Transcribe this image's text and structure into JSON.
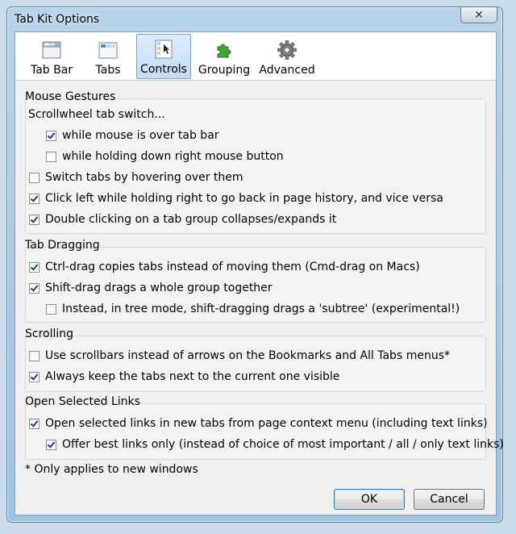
{
  "window": {
    "title": "Tab Kit Options"
  },
  "tabs": [
    {
      "label": "Tab Bar",
      "icon": "tab-bar-icon",
      "selected": false
    },
    {
      "label": "Tabs",
      "icon": "tabs-icon",
      "selected": false
    },
    {
      "label": "Controls",
      "icon": "controls-icon",
      "selected": true
    },
    {
      "label": "Grouping",
      "icon": "puzzle-piece-icon",
      "selected": false
    },
    {
      "label": "Advanced",
      "icon": "gear-icon",
      "selected": false
    }
  ],
  "mouse_gestures": {
    "heading": "Mouse Gestures",
    "scrollwheel_label": "Scrollwheel tab switch...",
    "items": [
      {
        "label": "while mouse is over tab bar",
        "checked": true
      },
      {
        "label": "while holding down right mouse button",
        "checked": false
      },
      {
        "label": "Switch tabs by hovering over them",
        "checked": false
      },
      {
        "label": "Click left while holding right to go back in page history, and vice versa",
        "checked": true
      },
      {
        "label": "Double clicking on a tab group collapses/expands it",
        "checked": true
      }
    ]
  },
  "tab_dragging": {
    "heading": "Tab Dragging",
    "items": [
      {
        "label": "Ctrl-drag copies tabs instead of moving them (Cmd-drag on Macs)",
        "checked": true
      },
      {
        "label": "Shift-drag drags a whole group together",
        "checked": true
      },
      {
        "label": "Instead, in tree mode, shift-dragging drags a 'subtree' (experimental!)",
        "checked": false
      }
    ]
  },
  "scrolling": {
    "heading": "Scrolling",
    "items": [
      {
        "label": "Use scrollbars instead of arrows on the Bookmarks and All Tabs menus*",
        "checked": false
      },
      {
        "label": "Always keep the tabs next to the current one visible",
        "checked": true
      }
    ]
  },
  "open_links": {
    "heading": "Open Selected Links",
    "items": [
      {
        "label": "Open selected links in new tabs from page context menu (including text links)",
        "checked": true
      },
      {
        "label": "Offer best links only (instead of choice of most important / all / only text links)",
        "checked": true
      }
    ]
  },
  "footnote": "* Only applies to new windows",
  "buttons": {
    "ok": "OK",
    "cancel": "Cancel"
  }
}
